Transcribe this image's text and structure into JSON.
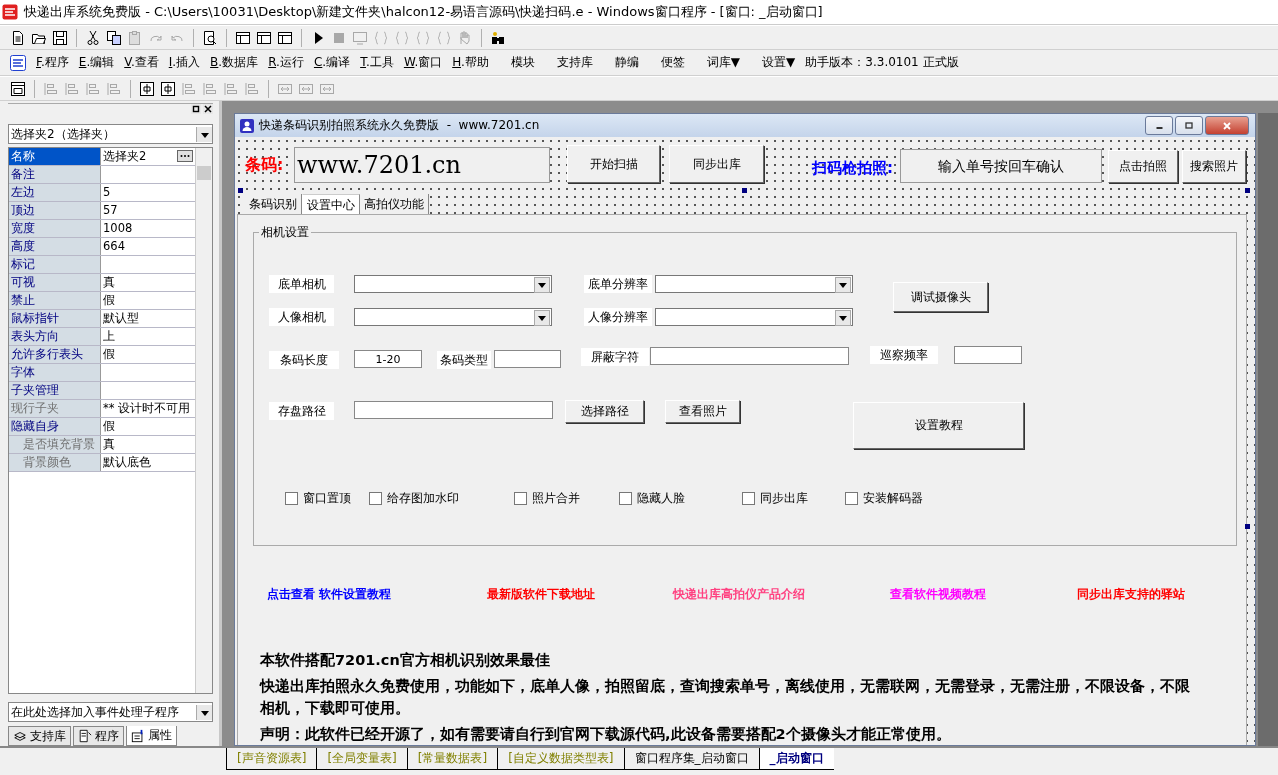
{
  "app_title": "快递出库系统免费版 - C:\\Users\\10031\\Desktop\\新建文件夹\\halcon12-易语言源码\\快递扫码.e - Windows窗口程序 - [窗口: _启动窗口]",
  "toolbar": [
    {
      "kind": "document",
      "disabled": false
    },
    {
      "kind": "folder",
      "disabled": false
    },
    {
      "kind": "save",
      "disabled": false
    },
    {
      "kind": "sep"
    },
    {
      "kind": "cut",
      "disabled": false
    },
    {
      "kind": "copy",
      "disabled": false
    },
    {
      "kind": "paste",
      "disabled": true
    },
    {
      "kind": "redo",
      "disabled": true
    },
    {
      "kind": "undo",
      "disabled": true
    },
    {
      "kind": "sep"
    },
    {
      "kind": "preview",
      "disabled": false
    },
    {
      "kind": "sep"
    },
    {
      "kind": "layout",
      "disabled": false
    },
    {
      "kind": "layout",
      "disabled": false
    },
    {
      "kind": "layout",
      "disabled": false
    },
    {
      "kind": "sep"
    },
    {
      "kind": "play",
      "disabled": false
    },
    {
      "kind": "stop",
      "disabled": true
    },
    {
      "kind": "monitor",
      "disabled": true
    },
    {
      "kind": "braces",
      "disabled": true
    },
    {
      "kind": "braces",
      "disabled": true
    },
    {
      "kind": "braces",
      "disabled": true
    },
    {
      "kind": "braces",
      "disabled": true
    },
    {
      "kind": "hand",
      "disabled": true
    },
    {
      "kind": "sep"
    },
    {
      "kind": "binoculars",
      "disabled": false
    }
  ],
  "menu": [
    {
      "key": "F",
      "label": ".程序"
    },
    {
      "key": "E",
      "label": ".编辑"
    },
    {
      "key": "V",
      "label": ".查看"
    },
    {
      "key": "I",
      "label": ".插入"
    },
    {
      "key": "B",
      "label": ".数据库"
    },
    {
      "key": "R",
      "label": ".运行"
    },
    {
      "key": "C",
      "label": ".编译"
    },
    {
      "key": "T",
      "label": ".工具"
    },
    {
      "key": "W",
      "label": ".窗口"
    },
    {
      "key": "H",
      "label": ".帮助"
    }
  ],
  "extra_menu": [
    "模块",
    "支持库",
    "静编",
    "便签",
    "词库▼",
    "设置▼"
  ],
  "version": "助手版本：3.3.0101 正式版",
  "layout_toolbar": [
    {
      "kind": "form",
      "disabled": false
    },
    {
      "kind": "sep"
    },
    {
      "kind": "align",
      "disabled": true
    },
    {
      "kind": "align",
      "disabled": true
    },
    {
      "kind": "align",
      "disabled": true
    },
    {
      "kind": "align",
      "disabled": true
    },
    {
      "kind": "sep"
    },
    {
      "kind": "center",
      "disabled": false
    },
    {
      "kind": "center",
      "disabled": false
    },
    {
      "kind": "align",
      "disabled": true
    },
    {
      "kind": "align",
      "disabled": true
    },
    {
      "kind": "align",
      "disabled": true
    },
    {
      "kind": "align",
      "disabled": true
    },
    {
      "kind": "sep"
    },
    {
      "kind": "size",
      "disabled": true
    },
    {
      "kind": "size",
      "disabled": true
    },
    {
      "kind": "size",
      "disabled": true
    }
  ],
  "properties": {
    "object": "选择夹2（选择夹）",
    "rows": [
      {
        "name": "名称",
        "value": "选择夹2",
        "selected": true,
        "disabled": false
      },
      {
        "name": "备注",
        "value": "",
        "selected": false,
        "disabled": false
      },
      {
        "name": "左边",
        "value": "5",
        "selected": false,
        "disabled": false
      },
      {
        "name": "顶边",
        "value": "57",
        "selected": false,
        "disabled": false
      },
      {
        "name": "宽度",
        "value": "1008",
        "selected": false,
        "disabled": false
      },
      {
        "name": "高度",
        "value": "664",
        "selected": false,
        "disabled": false
      },
      {
        "name": "标记",
        "value": "",
        "selected": false,
        "disabled": false
      },
      {
        "name": "可视",
        "value": "真",
        "selected": false,
        "disabled": false
      },
      {
        "name": "禁止",
        "value": "假",
        "selected": false,
        "disabled": false
      },
      {
        "name": "鼠标指针",
        "value": "默认型",
        "selected": false,
        "disabled": false
      },
      {
        "name": "表头方向",
        "value": "上",
        "selected": false,
        "disabled": false
      },
      {
        "name": "允许多行表头",
        "value": "假",
        "selected": false,
        "disabled": false
      },
      {
        "name": "字体",
        "value": "",
        "selected": false,
        "disabled": false
      },
      {
        "name": "子夹管理",
        "value": "",
        "selected": false,
        "disabled": false
      },
      {
        "name": "现行子夹",
        "value": "** 设计时不可用",
        "selected": false,
        "disabled": true
      },
      {
        "name": "隐藏自身",
        "value": "假",
        "selected": false,
        "disabled": false,
        "children": [
          {
            "name": "是否填充背景",
            "value": "真",
            "selected": false,
            "disabled": true
          },
          {
            "name": "背景颜色",
            "value": "默认底色",
            "selected": false,
            "disabled": true
          }
        ]
      }
    ],
    "event": "在此处选择加入事件处理子程序",
    "tabs": [
      {
        "label": "支持库",
        "kind": "library",
        "selected": false
      },
      {
        "label": "程序",
        "kind": "program",
        "selected": false
      },
      {
        "label": "属性",
        "kind": "properties",
        "selected": true
      }
    ]
  },
  "form": {
    "title": "快递条码识别拍照系统永久免费版  -  www.7201.cn",
    "barcode_label": "条码:",
    "barcode_value": "www.7201.cn",
    "action_buttons": [
      "开始扫描",
      "同步出库"
    ],
    "scan_label": "扫码枪拍照:",
    "order_value": "输入单号按回车确认",
    "photo_buttons": [
      "点击拍照",
      "搜索照片"
    ],
    "tabs": [
      {
        "label": "条码识别",
        "selected": false
      },
      {
        "label": "设置中心",
        "selected": true
      },
      {
        "label": "高拍仪功能",
        "selected": false
      }
    ],
    "group_title": "相机设置",
    "camera_rows": [
      {
        "label": "底单相机",
        "res_label": "底单分辨率"
      },
      {
        "label": "人像相机",
        "res_label": "人像分辨率"
      }
    ],
    "test_button": "调试摄像头",
    "barcode_length_label": "条码长度",
    "barcode_length": "1-20",
    "barcode_type_label": "条码类型",
    "mask_label": "屏蔽字符",
    "patrol_label": "巡察频率",
    "path_label": "存盘路径",
    "path_buttons": [
      "选择路径",
      "查看照片"
    ],
    "tutorial_button": "设置教程",
    "checkboxes": [
      {
        "label": "窗口置顶",
        "checked": false
      },
      {
        "label": "给存图加水印",
        "checked": false
      },
      {
        "label": "照片合并",
        "checked": false
      },
      {
        "label": "隐藏人脸",
        "checked": false
      },
      {
        "label": "同步出库",
        "checked": false
      },
      {
        "label": "安装解码器",
        "checked": false
      }
    ],
    "links": [
      {
        "label": "点击查看 软件设置教程",
        "color": "#0000ff"
      },
      {
        "label": "最新版软件下载地址",
        "color": "#ff0000"
      },
      {
        "label": "快递出库高拍仪产品介绍",
        "color": "#ff4080"
      },
      {
        "label": "查看软件视频教程",
        "color": "#ff00ff"
      },
      {
        "label": "同步出库支持的驿站",
        "color": "#ff0000"
      }
    ],
    "paragraphs": [
      "本软件搭配7201.cn官方相机识别效果最佳",
      "快递出库拍照永久免费使用，功能如下，底单人像，拍照留底，查询搜索单号，离线使用，无需联网，无需登录，无需注册，不限设备，不限相机，下载即可使用。",
      "声明：此软件已经开源了，如有需要请自行到官网下载源代码,此设备需要搭配2个摄像头才能正常使用。"
    ]
  },
  "bottom_tabs": [
    {
      "label": "[声音资源表]",
      "kind": "table",
      "selected": false
    },
    {
      "label": "[全局变量表]",
      "kind": "table",
      "selected": false
    },
    {
      "label": "[常量数据表]",
      "kind": "table",
      "selected": false
    },
    {
      "label": "[自定义数据类型表]",
      "kind": "table",
      "selected": false
    },
    {
      "label": "窗口程序集_启动窗口",
      "kind": "module",
      "selected": false
    },
    {
      "label": "_启动窗口",
      "kind": "module",
      "selected": true
    }
  ]
}
